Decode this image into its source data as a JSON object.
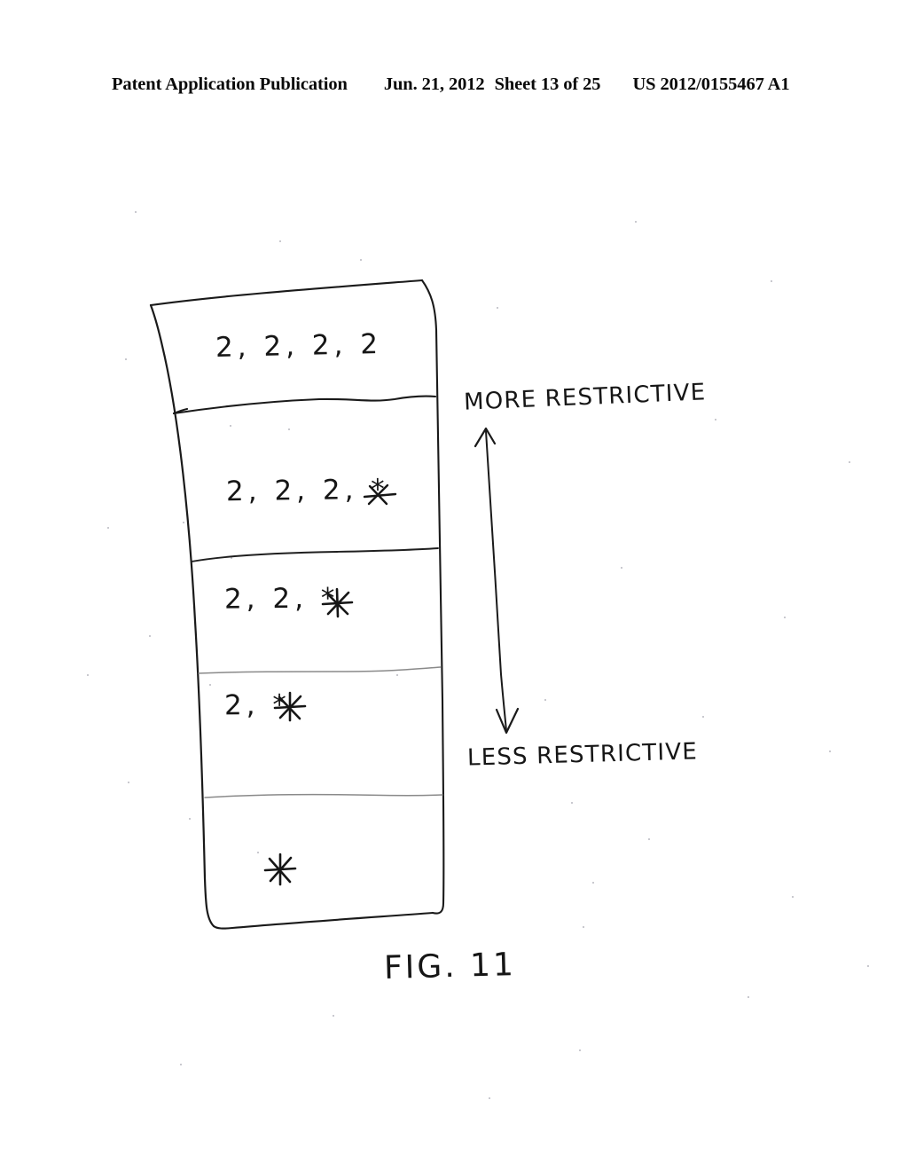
{
  "header": {
    "publication": "Patent Application Publication",
    "date": "Jun. 21, 2012",
    "sheet": "Sheet 13 of 25",
    "patent_number": "US 2012/0155467 A1"
  },
  "figure": {
    "caption": "FIG. 11",
    "table_rows": [
      {
        "label": "2, 2, 2, 2"
      },
      {
        "label": "2, 2, 2, *"
      },
      {
        "label": "2, 2, *"
      },
      {
        "label": "2, *"
      },
      {
        "label": "*"
      }
    ],
    "axis": {
      "top_label": "MORE RESTRICTIVE",
      "bottom_label": "LESS RESTRICTIVE"
    },
    "ink_color": "#161616",
    "paper_color": "#ffffff"
  }
}
